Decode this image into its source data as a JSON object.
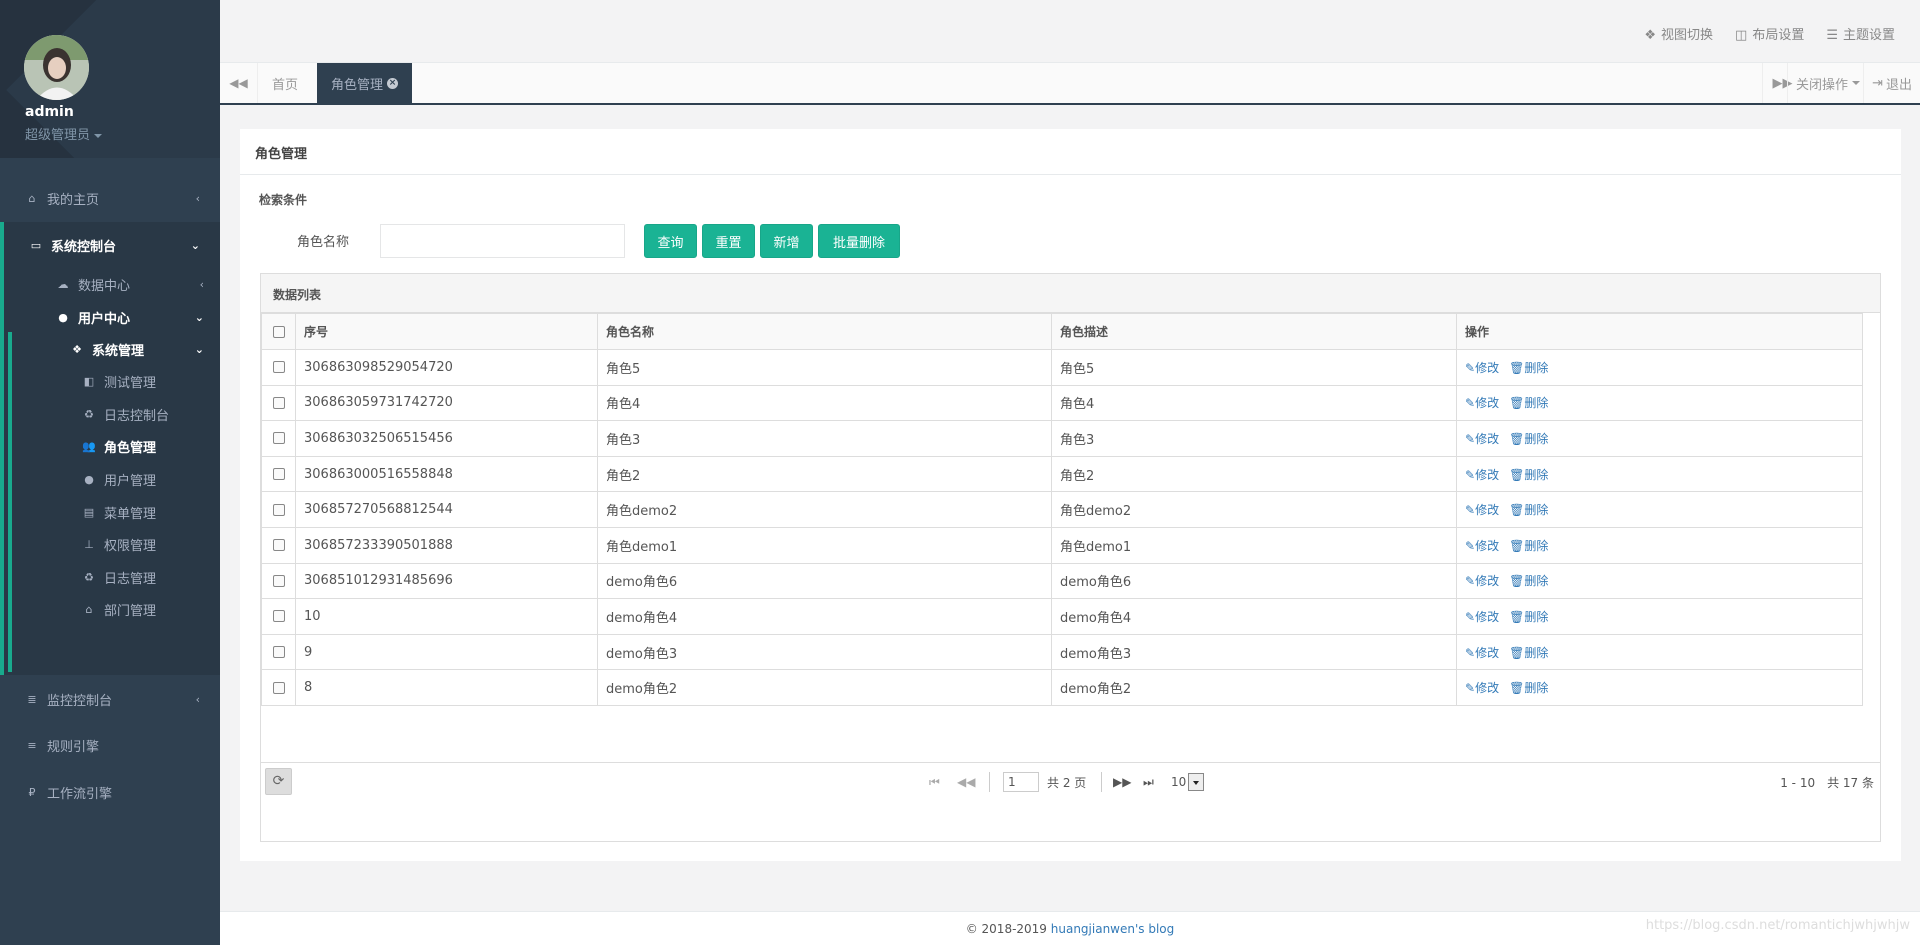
{
  "profile": {
    "name": "admin",
    "role": "超级管理员"
  },
  "sidebar": {
    "items": [
      {
        "label": "我的主页",
        "icon": "home-icon"
      },
      {
        "label": "系统控制台",
        "icon": "desktop-icon"
      },
      {
        "label": "监控控制台",
        "icon": "monitor-icon"
      },
      {
        "label": "规则引擎",
        "icon": "database-icon"
      },
      {
        "label": "工作流引擎",
        "icon": "workflow-icon"
      }
    ],
    "sub": {
      "data_center": "数据中心",
      "user_center": "用户中心",
      "system_manage": "系统管理",
      "leaves": [
        {
          "label": "测试管理",
          "icon": "test-icon"
        },
        {
          "label": "日志控制台",
          "icon": "recycle-icon"
        },
        {
          "label": "角色管理",
          "icon": "users-icon"
        },
        {
          "label": "用户管理",
          "icon": "user-icon"
        },
        {
          "label": "菜单管理",
          "icon": "menu-icon"
        },
        {
          "label": "权限管理",
          "icon": "sitemap-icon"
        },
        {
          "label": "日志管理",
          "icon": "recycle-icon"
        },
        {
          "label": "部门管理",
          "icon": "bank-icon"
        }
      ]
    }
  },
  "header": {
    "links": [
      "视图切换",
      "布局设置",
      "主题设置"
    ]
  },
  "tabs": {
    "home": "首页",
    "active": "角色管理",
    "close_ops": "关闭操作",
    "logout": "退出"
  },
  "panel": {
    "title": "角色管理",
    "search_title": "检索条件",
    "field_label": "角色名称",
    "field_value": "",
    "buttons": {
      "query": "查询",
      "reset": "重置",
      "add": "新增",
      "batch_delete": "批量删除"
    }
  },
  "grid": {
    "caption": "数据列表",
    "columns": [
      "序号",
      "角色名称",
      "角色描述",
      "操作"
    ],
    "rows": [
      [
        "306863098529054720",
        "角色5",
        "角色5"
      ],
      [
        "306863059731742720",
        "角色4",
        "角色4"
      ],
      [
        "306863032506515456",
        "角色3",
        "角色3"
      ],
      [
        "306863000516558848",
        "角色2",
        "角色2"
      ],
      [
        "306857270568812544",
        "角色demo2",
        "角色demo2"
      ],
      [
        "306857233390501888",
        "角色demo1",
        "角色demo1"
      ],
      [
        "306851012931485696",
        "demo角色6",
        "demo角色6"
      ],
      [
        "10",
        "demo角色4",
        "demo角色4"
      ],
      [
        "9",
        "demo角色3",
        "demo角色3"
      ],
      [
        "8",
        "demo角色2",
        "demo角色2"
      ]
    ],
    "actions": {
      "edit": "修改",
      "delete": "删除"
    },
    "pager": {
      "page": "1",
      "total_pages": "共 2 页",
      "page_size": "10",
      "info": "1 - 10　共 17 条"
    }
  },
  "footer": {
    "copyright": "© 2018-2019 ",
    "link": "huangjianwen's blog"
  },
  "watermark": "https://blog.csdn.net/romantichjwhjwhjw",
  "colors": {
    "sidebar": "#2f4050",
    "accent": "#1ab394",
    "link": "#337ab7"
  }
}
